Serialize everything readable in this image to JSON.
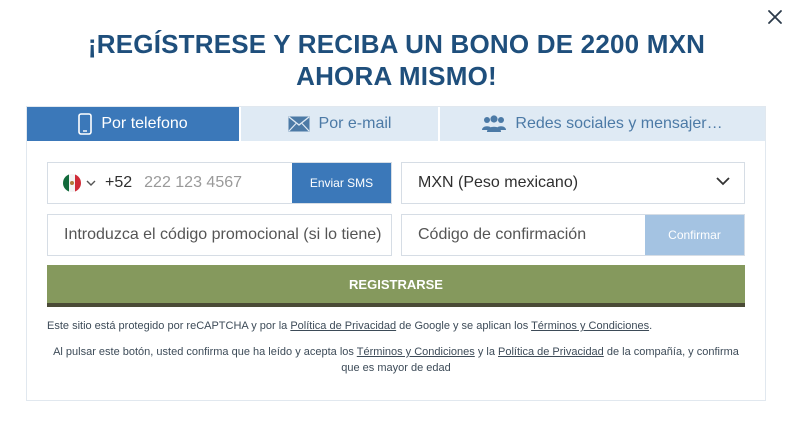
{
  "close": {
    "icon": "close-icon"
  },
  "heading": "¡REGÍSTRESE Y RECIBA UN BONO DE 2200 MXN AHORA MISMO!",
  "tabs": [
    {
      "label": "Por telefono",
      "icon": "phone-icon",
      "active": true
    },
    {
      "label": "Por e-mail",
      "icon": "envelope-icon",
      "active": false
    },
    {
      "label": "Redes sociales y mensajer…",
      "icon": "users-icon",
      "active": false
    }
  ],
  "phone": {
    "flag": "mexico-flag",
    "code": "+52",
    "placeholder": "222 123 4567",
    "sms_button": "Enviar SMS"
  },
  "currency": {
    "selected": "MXN (Peso mexicano)"
  },
  "promo": {
    "placeholder": "Introduzca el código promocional (si lo tiene)"
  },
  "confirmation": {
    "placeholder": "Código de confirmación",
    "button": "Confirmar"
  },
  "register_button": "REGISTRARSE",
  "notes": {
    "recaptcha": {
      "t1": "Este sitio está protegido por reCAPTCHA y por la ",
      "l1": "Política de Privacidad",
      "t2": " de Google y se aplican los ",
      "l2": "Términos y Condiciones",
      "t3": "."
    },
    "consent": {
      "t1": "Al pulsar este botón, usted confirma que ha leído y acepta los ",
      "l1": "Términos y Condiciones",
      "t2": " y la ",
      "l2": "Política de Privacidad",
      "t3": " de la compañía, y confirma que es mayor de edad"
    }
  },
  "colors": {
    "heading": "#1f4f7c",
    "tab_active": "#3b78b9",
    "tab_inactive": "#dfeaf4",
    "register": "#85995d",
    "confirm_disabled": "#a4c3e2"
  }
}
